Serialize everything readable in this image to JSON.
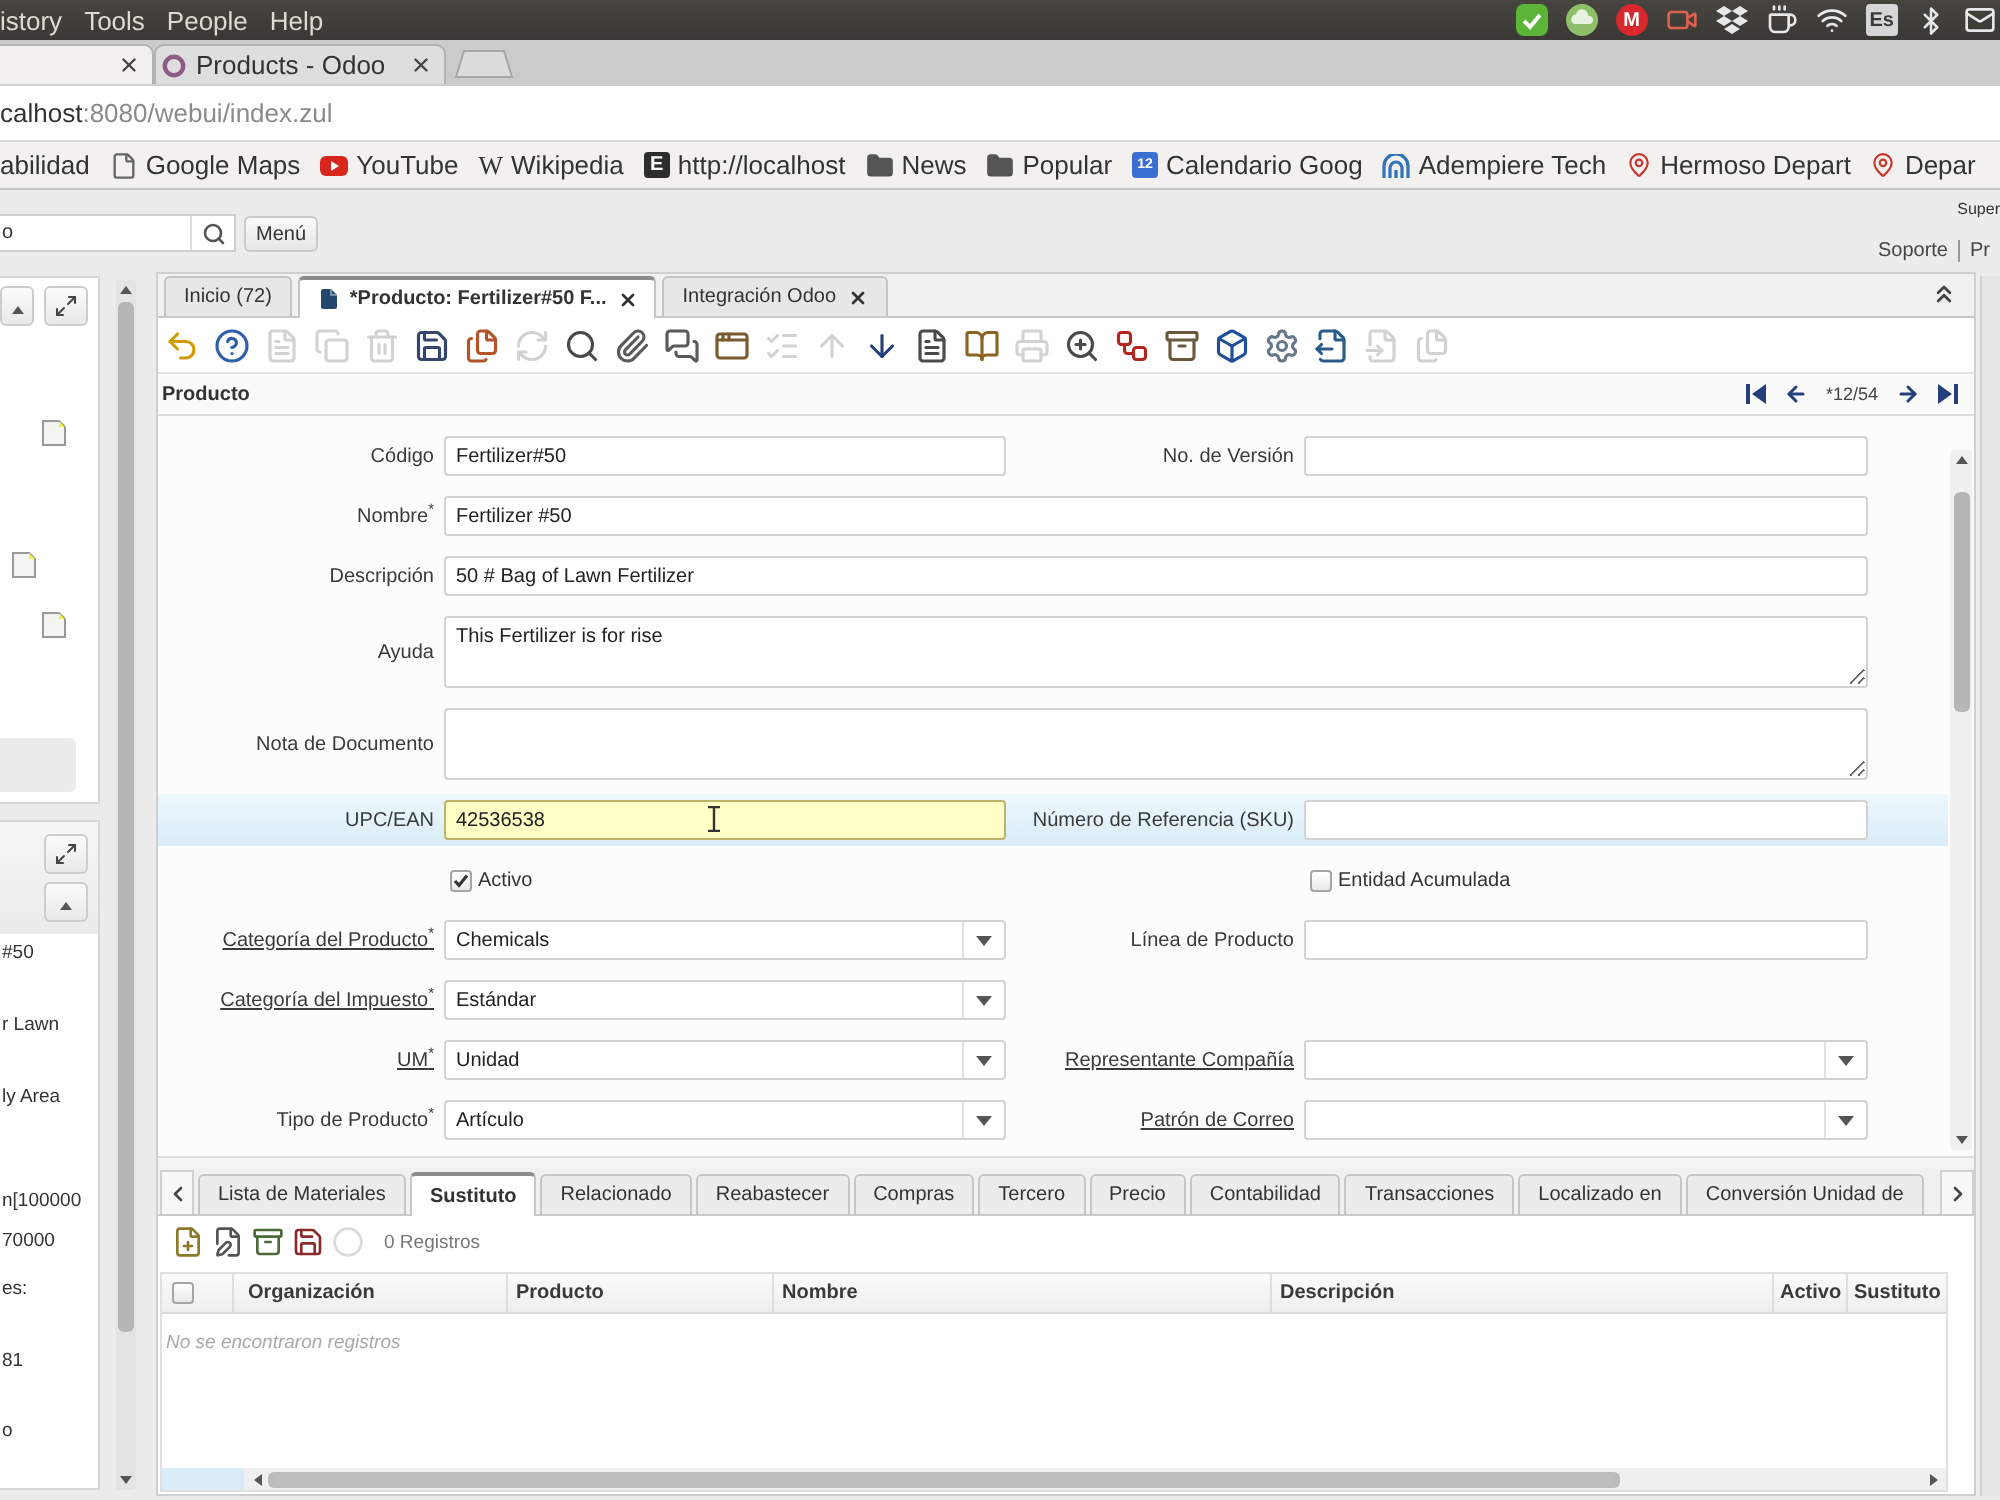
{
  "os_menu": {
    "items": [
      "istory",
      "Tools",
      "People",
      "Help"
    ]
  },
  "tray": {
    "badge": "M",
    "keyboard_layout": "Es"
  },
  "browser_tabs": [
    {
      "selected": true
    },
    {
      "title": "Products - Odoo",
      "selected": false
    }
  ],
  "address_bar": {
    "host": "calhost",
    "path": ":8080/webui/index.zul"
  },
  "bookmarks": [
    {
      "kind": "plain",
      "label": "abilidad"
    },
    {
      "kind": "page",
      "label": "Google Maps"
    },
    {
      "kind": "video",
      "label": "YouTube"
    },
    {
      "kind": "letter",
      "badge": "W",
      "label": "Wikipedia"
    },
    {
      "kind": "tile",
      "badge": "E",
      "label": "http://localhost"
    },
    {
      "kind": "folder",
      "label": "News"
    },
    {
      "kind": "folder",
      "label": "Popular"
    },
    {
      "kind": "calendar",
      "badge": "12",
      "label": "Calendario Goog"
    },
    {
      "kind": "arches",
      "label": "Adempiere Tech"
    },
    {
      "kind": "pin",
      "label": "Hermoso Depart"
    },
    {
      "kind": "pin",
      "label": "Depar"
    }
  ],
  "app_header": {
    "search_value": "o",
    "menu_button": "Menú",
    "user": "Super",
    "links": [
      "Soporte",
      "Pr"
    ]
  },
  "side_panel": {
    "lines": [
      "#50",
      "r Lawn",
      "ly Area",
      "n[100000",
      "70000",
      "es:",
      "81",
      "o"
    ]
  },
  "window_tabs": [
    {
      "label": "Inicio (72)",
      "selected": false,
      "closable": false
    },
    {
      "label": "*Producto: Fertilizer#50 F...",
      "selected": true,
      "closable": true
    },
    {
      "label": "Integración Odoo",
      "selected": false,
      "closable": true
    }
  ],
  "toolbar": [
    {
      "disabled": false
    },
    {
      "disabled": false
    },
    {
      "disabled": true
    },
    {
      "disabled": true
    },
    {
      "disabled": true
    },
    {
      "disabled": false
    },
    {
      "disabled": false
    },
    {
      "disabled": true
    },
    {
      "disabled": false
    },
    {
      "disabled": false
    },
    {
      "disabled": false
    },
    {
      "disabled": false
    },
    {
      "disabled": true
    },
    {
      "disabled": true
    },
    {
      "disabled": false
    },
    {
      "disabled": false
    },
    {
      "disabled": false
    },
    {
      "disabled": true
    },
    {
      "disabled": false
    },
    {
      "disabled": false
    },
    {
      "disabled": false
    },
    {
      "disabled": false
    },
    {
      "disabled": false
    },
    {
      "disabled": false
    },
    {
      "disabled": true
    },
    {
      "disabled": true
    }
  ],
  "record_header": {
    "title": "Producto",
    "position": "*12/54"
  },
  "form": {
    "rows": [
      {
        "kind": "pair",
        "fields": [
          {
            "kind": "text",
            "label": "Código",
            "value": "Fertilizer#50",
            "link": false,
            "focused": false
          },
          {
            "kind": "text",
            "label": "No. de Versión",
            "link": false,
            "focused": false
          }
        ]
      },
      {
        "kind": "single",
        "fields": [
          {
            "kind": "text",
            "label": "Nombre$^{*}$",
            "value": "Fertilizer #50",
            "link": false,
            "focused": false
          }
        ]
      },
      {
        "kind": "single",
        "fields": [
          {
            "kind": "text",
            "label": "Descripción",
            "value": "50 # Bag of Lawn Fertilizer",
            "link": false,
            "focused": false
          }
        ]
      },
      {
        "kind": "single",
        "fields": [
          {
            "kind": "textarea",
            "label": "Ayuda",
            "value": "This Fertilizer is for rise",
            "link": false,
            "focused": false
          }
        ]
      },
      {
        "kind": "single",
        "fields": [
          {
            "kind": "textarea",
            "label": "Nota de Documento",
            "link": false,
            "focused": false
          }
        ]
      },
      {
        "kind": "pair",
        "fields": [
          {
            "kind": "text",
            "label": "UPC/EAN",
            "value": "42536538",
            "link": false,
            "focused": true
          },
          {
            "kind": "text",
            "label": "Número de Referencia (SKU)",
            "link": false,
            "focused": false
          }
        ]
      },
      {
        "kind": "pair",
        "fields": [
          {
            "kind": "checkbox",
            "label": "Activo",
            "checked": true
          },
          {
            "kind": "checkbox",
            "label": "Entidad Acumulada",
            "checked": false
          }
        ]
      },
      {
        "kind": "pair",
        "fields": [
          {
            "kind": "lookup",
            "label": "Categoría del Producto$^{*}$",
            "value": "Chemicals",
            "link": true,
            "focused": false
          },
          {
            "kind": "text",
            "label": "Línea de Producto",
            "link": false,
            "focused": false
          }
        ]
      },
      {
        "kind": "pair",
        "fields": [
          {
            "kind": "lookup",
            "label": "Categoría del Impuesto$^{*}$",
            "value": "Estándar",
            "link": true,
            "focused": false
          }
        ]
      },
      {
        "kind": "pair",
        "fields": [
          {
            "kind": "lookup",
            "label": "UM$^{*}$",
            "value": "Unidad",
            "link": true,
            "focused": false
          },
          {
            "kind": "lookup",
            "label": "Representante Compañía",
            "link": true,
            "focused": false
          }
        ]
      },
      {
        "kind": "pair",
        "fields": [
          {
            "kind": "lookup",
            "label": "Tipo de Producto$^{*}$",
            "value": "Artículo",
            "link": false,
            "focused": false
          },
          {
            "kind": "lookup",
            "label": "Patrón de Correo",
            "link": true,
            "focused": false
          }
        ]
      }
    ]
  },
  "detail_tabs": [
    {
      "label": "Lista de Materiales",
      "selected": false
    },
    {
      "label": "Sustituto",
      "selected": true
    },
    {
      "label": "Relacionado",
      "selected": false
    },
    {
      "label": "Reabastecer",
      "selected": false
    },
    {
      "label": "Compras",
      "selected": false
    },
    {
      "label": "Tercero",
      "selected": false
    },
    {
      "label": "Precio",
      "selected": false
    },
    {
      "label": "Contabilidad",
      "selected": false
    },
    {
      "label": "Transacciones",
      "selected": false
    },
    {
      "label": "Localizado en",
      "selected": false
    },
    {
      "label": "Conversión Unidad de",
      "selected": false
    }
  ],
  "detail_toolbar": {
    "buttons": [
      {
        "disabled": false
      },
      {
        "disabled": false
      },
      {
        "disabled": false
      },
      {
        "disabled": false
      },
      {
        "disabled": true
      }
    ],
    "count": "0 Registros"
  },
  "grid": {
    "select_all_checked": false,
    "columns": [
      "Organización",
      "Producto",
      "Nombre",
      "Descripción",
      "Activo",
      "Sustituto"
    ],
    "empty_message": "No se encontraron registros"
  }
}
